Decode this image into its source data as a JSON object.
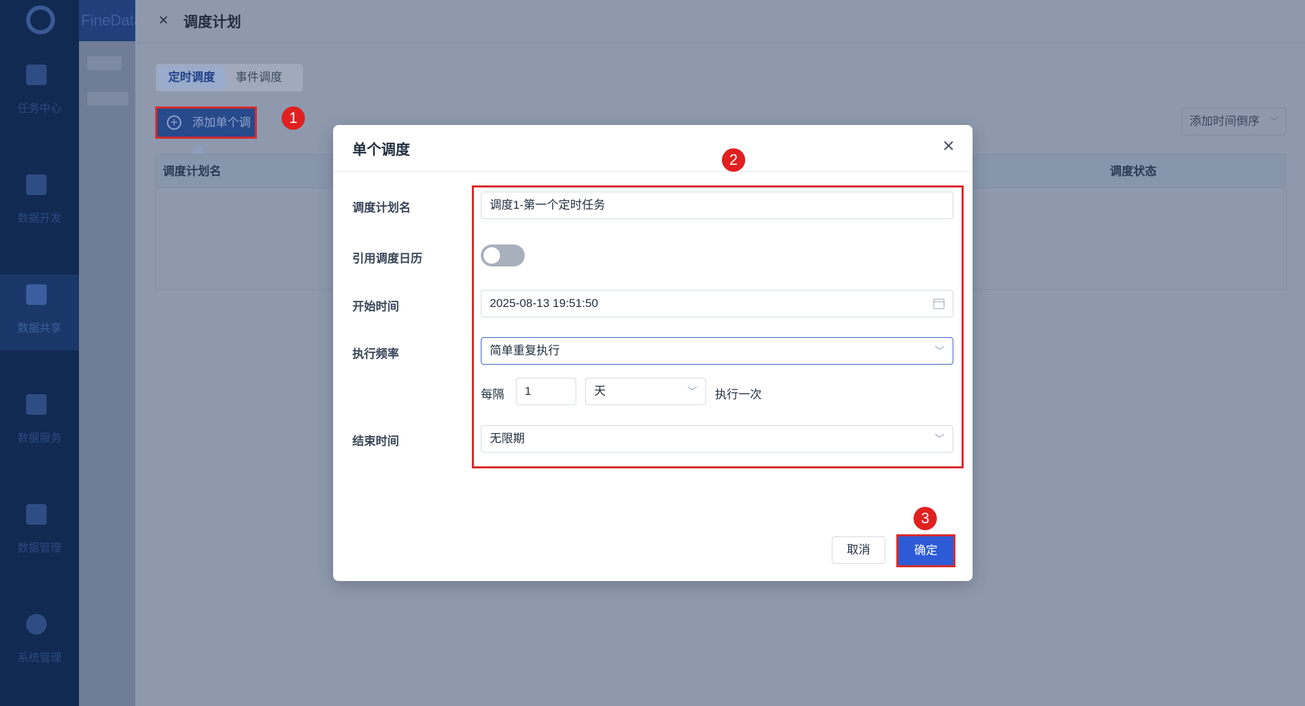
{
  "app": {
    "brand": "FineData"
  },
  "sidebar": {
    "items": [
      {
        "label": "任务中心",
        "active": false
      },
      {
        "label": "数据开发",
        "active": false
      },
      {
        "label": "数据共享",
        "active": true
      },
      {
        "label": "数据服务",
        "active": false
      },
      {
        "label": "数据管理",
        "active": false
      },
      {
        "label": "系统管理",
        "active": false
      }
    ]
  },
  "drawer": {
    "title": "调度计划",
    "tabs": [
      {
        "label": "定时调度",
        "active": true
      },
      {
        "label": "事件调度",
        "active": false
      }
    ],
    "add_button": "添加单个调度",
    "sort_select": "添加时间倒序",
    "table": {
      "columns": [
        "调度计划名",
        "调度状态"
      ]
    }
  },
  "modal": {
    "title": "单个调度",
    "fields": {
      "plan_name_label": "调度计划名",
      "plan_name_value": "调度1-第一个定时任务",
      "calendar_label": "引用调度日历",
      "calendar_enabled": false,
      "start_time_label": "开始时间",
      "start_time_value": "2025-08-13 19:51:50",
      "frequency_label": "执行频率",
      "frequency_value": "简单重复执行",
      "every_label": "每隔",
      "every_value": "1",
      "unit_value": "天",
      "run_once_label": "执行一次",
      "end_time_label": "结束时间",
      "end_time_value": "无限期"
    },
    "cancel_button": "取消",
    "ok_button": "确定"
  },
  "annotations": {
    "step1": "1",
    "step2": "2",
    "step3": "3"
  },
  "colors": {
    "accent": "#2d5bd6",
    "highlight": "#d82b2b",
    "badge": "#e02020"
  }
}
